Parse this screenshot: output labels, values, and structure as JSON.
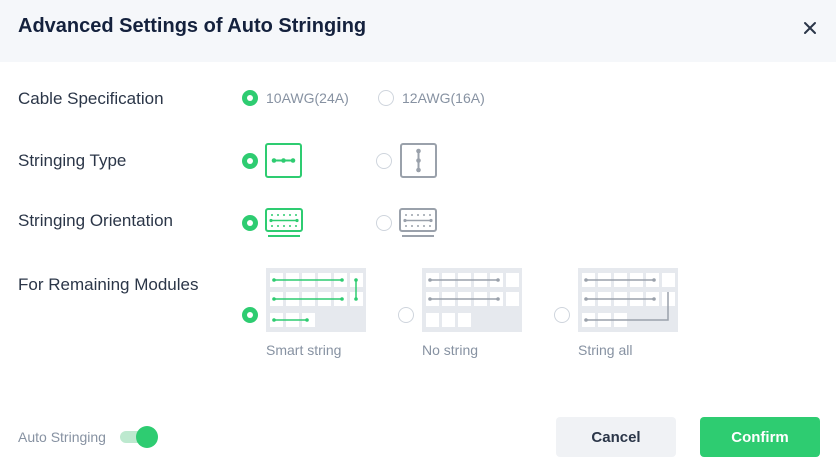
{
  "dialog": {
    "title": "Advanced Settings of Auto Stringing",
    "close_icon": "close-icon"
  },
  "cable": {
    "label": "Cable Specification",
    "options": [
      {
        "label": "10AWG(24A)",
        "selected": true
      },
      {
        "label": "12AWG(16A)",
        "selected": false
      }
    ]
  },
  "stringing_type": {
    "label": "Stringing Type",
    "options": [
      {
        "icon": "horizontal-string-icon",
        "selected": true
      },
      {
        "icon": "vertical-string-icon",
        "selected": false
      }
    ]
  },
  "orientation": {
    "label": "Stringing Orientation",
    "options": [
      {
        "icon": "landscape-panel-icon",
        "selected": true
      },
      {
        "icon": "portrait-panel-icon",
        "selected": false
      }
    ]
  },
  "remaining": {
    "label": "For Remaining Modules",
    "options": [
      {
        "label": "Smart string",
        "selected": true
      },
      {
        "label": "No string",
        "selected": false
      },
      {
        "label": "String all",
        "selected": false
      }
    ]
  },
  "footer": {
    "auto_label": "Auto Stringing",
    "auto_on": true,
    "cancel_label": "Cancel",
    "confirm_label": "Confirm"
  },
  "colors": {
    "accent": "#2ecc71",
    "muted_text": "#8792a2",
    "title_text": "#14213d",
    "icon_gray": "#9aa1ab"
  }
}
